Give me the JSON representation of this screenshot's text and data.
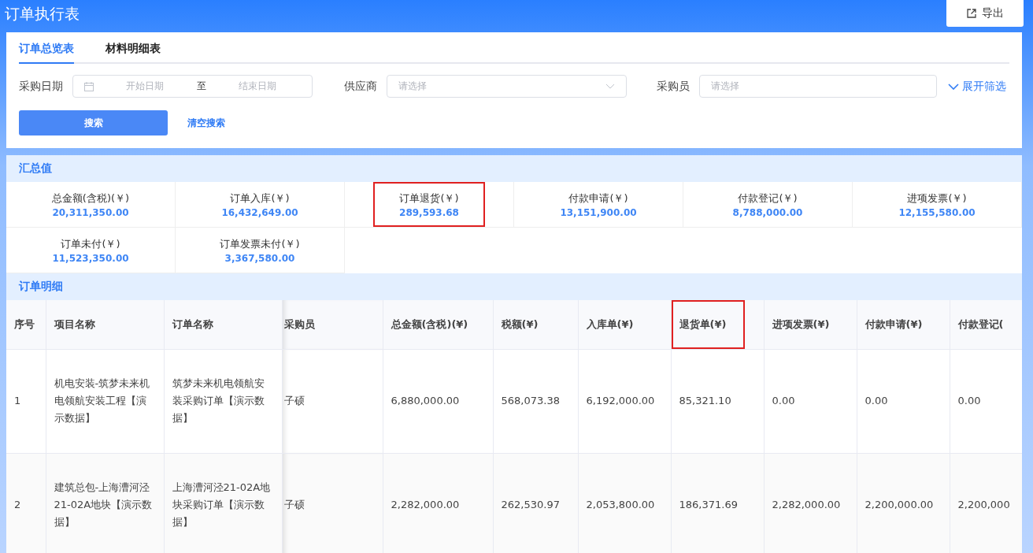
{
  "window": {
    "title": "订单执行表"
  },
  "export_button": {
    "label": "导出"
  },
  "tabs": [
    {
      "label": "订单总览表",
      "selected": true
    },
    {
      "label": "材料明细表",
      "selected": false
    }
  ],
  "filters": {
    "date": {
      "label": "采购日期",
      "start_placeholder": "开始日期",
      "separator": "至",
      "end_placeholder": "结束日期"
    },
    "supplier": {
      "label": "供应商",
      "placeholder": "请选择"
    },
    "buyer": {
      "label": "采购员",
      "placeholder": "请选择"
    },
    "expand": "展开筛选",
    "search": "搜索",
    "clear": "清空搜索"
  },
  "summary": {
    "title": "汇总值",
    "items": [
      {
        "label": "总金额(含税)(￥)",
        "value": "20,311,350.00",
        "highlighted": false
      },
      {
        "label": "订单入库(￥)",
        "value": "16,432,649.00",
        "highlighted": false
      },
      {
        "label": "订单退货(￥)",
        "value": "289,593.68",
        "highlighted": true
      },
      {
        "label": "付款申请(￥)",
        "value": "13,151,900.00",
        "highlighted": false
      },
      {
        "label": "付款登记(￥)",
        "value": "8,788,000.00",
        "highlighted": false
      },
      {
        "label": "进项发票(￥)",
        "value": "12,155,580.00",
        "highlighted": false
      },
      {
        "label": "订单未付(￥)",
        "value": "11,523,350.00",
        "highlighted": false
      },
      {
        "label": "订单发票未付(￥)",
        "value": "3,367,580.00",
        "highlighted": false
      }
    ]
  },
  "table": {
    "title": "订单明细",
    "columns": [
      {
        "label": "序号",
        "highlighted": false
      },
      {
        "label": "项目名称",
        "highlighted": false
      },
      {
        "label": "订单名称",
        "highlighted": false
      },
      {
        "label": "采购员",
        "highlighted": false
      },
      {
        "label": "总金额(含税)(¥)",
        "highlighted": false
      },
      {
        "label": "税额(¥)",
        "highlighted": false
      },
      {
        "label": "入库单(¥)",
        "highlighted": false
      },
      {
        "label": "退货单(¥)",
        "highlighted": true
      },
      {
        "label": "进项发票(¥)",
        "highlighted": false
      },
      {
        "label": "付款申请(¥)",
        "highlighted": false
      },
      {
        "label": "付款登记(",
        "highlighted": false
      }
    ],
    "rows": [
      [
        "1",
        "机电安装-筑梦未来机电领航安装工程【演示数据】",
        "筑梦未来机电领航安装采购订单【演示数据】",
        "子硕",
        "6,880,000.00",
        "568,073.38",
        "6,192,000.00",
        "85,321.10",
        "0.00",
        "0.00",
        "0.00"
      ],
      [
        "2",
        "建筑总包-上海漕河泾21-02A地块【演示数据】",
        "上海漕河泾21-02A地块采购订单【演示数据】",
        "子硕",
        "2,282,000.00",
        "262,530.97",
        "2,053,800.00",
        "186,371.69",
        "2,282,000.00",
        "2,200,000.00",
        "2,200,000"
      ]
    ]
  }
}
